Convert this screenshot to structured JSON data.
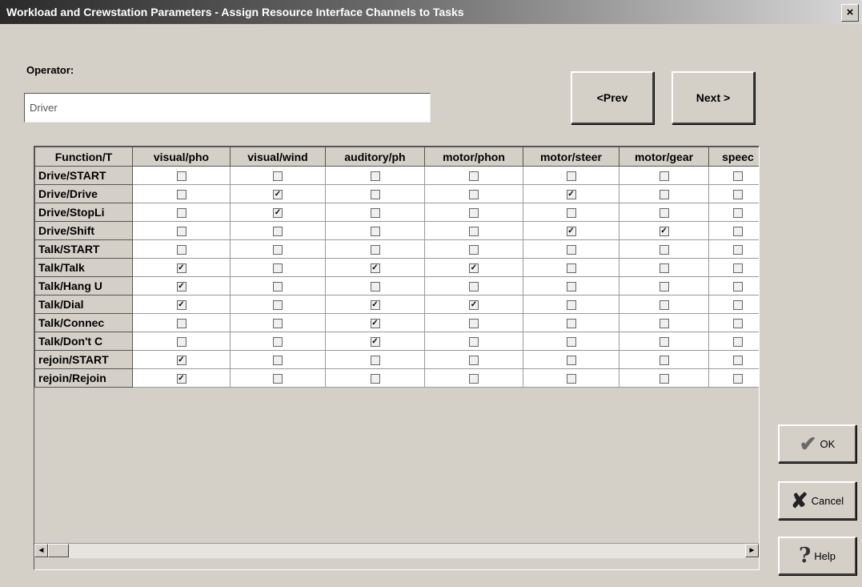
{
  "window": {
    "title": "Workload and Crewstation Parameters - Assign Resource Interface Channels to Tasks",
    "close_glyph": "×"
  },
  "operator": {
    "label": "Operator:",
    "value": "Driver"
  },
  "nav": {
    "prev_label": "<Prev",
    "next_label": "Next >"
  },
  "grid": {
    "columns": [
      "Function/T",
      "visual/pho",
      "visual/wind",
      "auditory/ph",
      "motor/phon",
      "motor/steer",
      "motor/gear",
      "speec"
    ],
    "rows": [
      {
        "label": "Drive/START",
        "checks": [
          false,
          false,
          false,
          false,
          false,
          false,
          false
        ]
      },
      {
        "label": "Drive/Drive",
        "checks": [
          false,
          true,
          false,
          false,
          true,
          false,
          false
        ]
      },
      {
        "label": "Drive/StopLi",
        "checks": [
          false,
          true,
          false,
          false,
          false,
          false,
          false
        ]
      },
      {
        "label": "Drive/Shift",
        "checks": [
          false,
          false,
          false,
          false,
          true,
          true,
          false
        ]
      },
      {
        "label": "Talk/START",
        "checks": [
          false,
          false,
          false,
          false,
          false,
          false,
          false
        ]
      },
      {
        "label": "Talk/Talk",
        "checks": [
          true,
          false,
          true,
          true,
          false,
          false,
          false
        ]
      },
      {
        "label": "Talk/Hang U",
        "checks": [
          true,
          false,
          false,
          false,
          false,
          false,
          false
        ]
      },
      {
        "label": "Talk/Dial",
        "checks": [
          true,
          false,
          true,
          true,
          false,
          false,
          false
        ]
      },
      {
        "label": "Talk/Connec",
        "checks": [
          false,
          false,
          true,
          false,
          false,
          false,
          false
        ]
      },
      {
        "label": "Talk/Don't C",
        "checks": [
          false,
          false,
          true,
          false,
          false,
          false,
          false
        ]
      },
      {
        "label": "rejoin/START",
        "checks": [
          true,
          false,
          false,
          false,
          false,
          false,
          false
        ]
      },
      {
        "label": "rejoin/Rejoin",
        "checks": [
          true,
          false,
          false,
          false,
          false,
          false,
          false
        ]
      }
    ]
  },
  "scrollbar": {
    "left_arrow": "◄",
    "right_arrow": "►"
  },
  "buttons": {
    "ok_label": "OK",
    "ok_icon": "✔",
    "cancel_label": "Cancel",
    "cancel_icon": "✘",
    "help_label": "Help",
    "help_icon": "?"
  },
  "checkbox_glyph": "✓"
}
